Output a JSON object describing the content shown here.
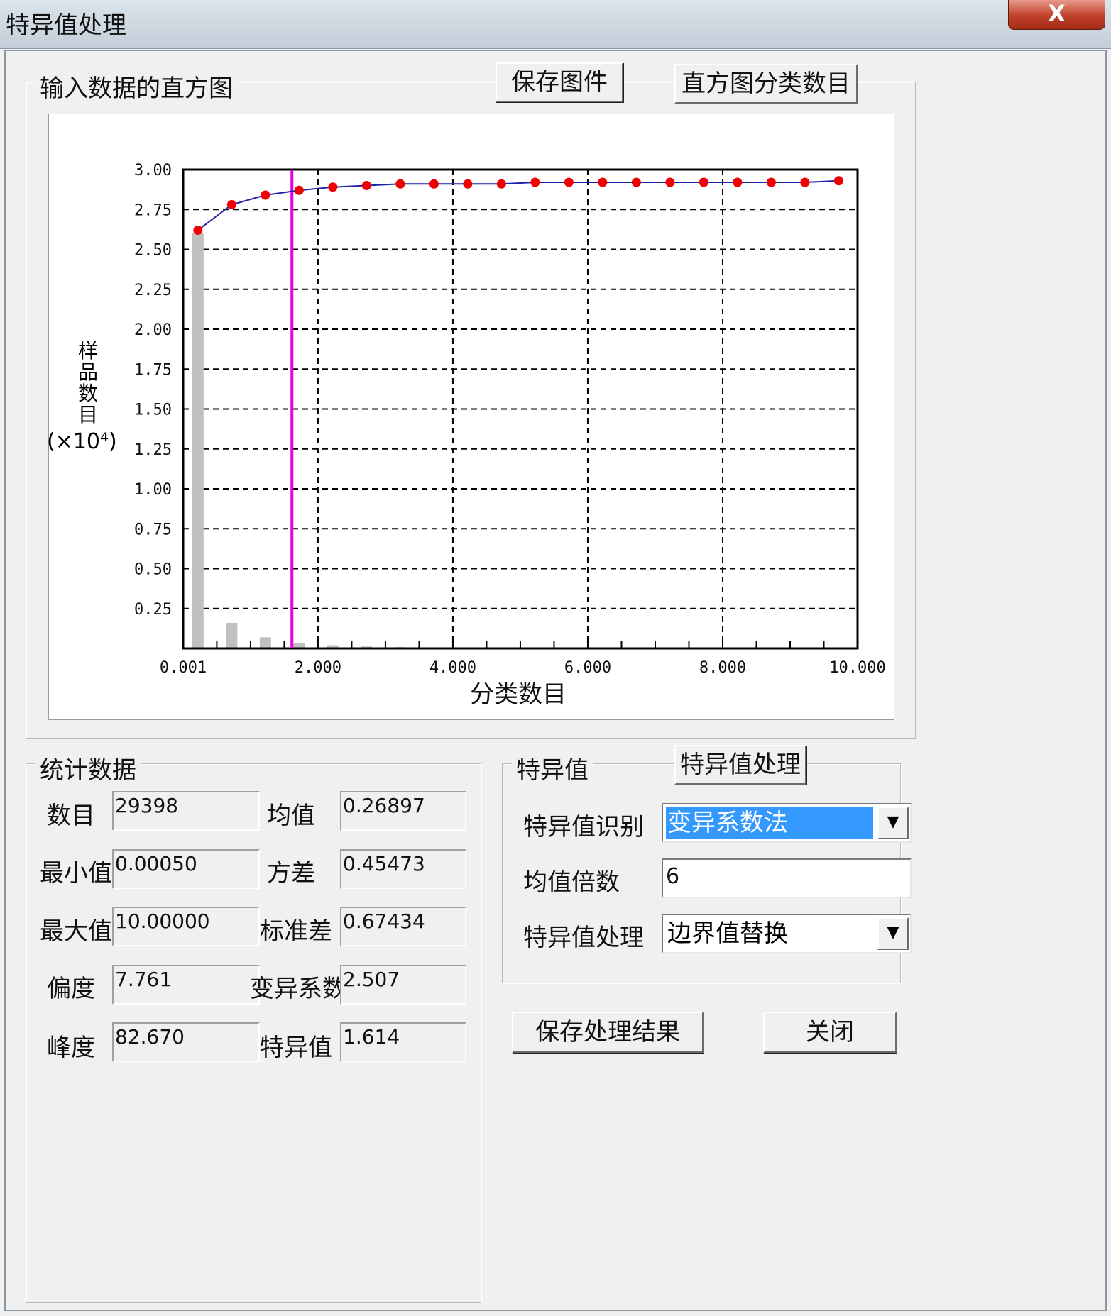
{
  "window": {
    "title": "特异值处理",
    "close_glyph": "X"
  },
  "histogram": {
    "group_title": "输入数据的直方图",
    "save_figure_button": "保存图件",
    "bins_button": "直方图分类数目"
  },
  "chart_data": {
    "type": "bar",
    "ylabel_chars": [
      "样",
      "品",
      "数",
      "目"
    ],
    "ylabel_unit": "(×10⁴)",
    "xlabel": "分类数目",
    "xticks": [
      "0.001",
      "2.000",
      "4.000",
      "6.000",
      "8.000",
      "10.000"
    ],
    "yticks": [
      "0.25",
      "0.50",
      "0.75",
      "1.00",
      "1.25",
      "1.50",
      "1.75",
      "2.00",
      "2.25",
      "2.50",
      "2.75",
      "3.00"
    ],
    "xlim": [
      0.001,
      10.0
    ],
    "ylim": [
      0,
      3.0
    ],
    "grid": true,
    "bars": {
      "x": [
        0.22,
        0.72,
        1.22,
        1.72,
        2.22,
        2.72,
        3.22
      ],
      "values": [
        2.6,
        0.16,
        0.07,
        0.035,
        0.02,
        0.012,
        0.008
      ],
      "color": "#c0c0c0"
    },
    "cumulative_line": {
      "x": [
        0.22,
        0.72,
        1.22,
        1.72,
        2.22,
        2.72,
        3.22,
        3.72,
        4.22,
        4.72,
        5.22,
        5.72,
        6.22,
        6.72,
        7.22,
        7.72,
        8.22,
        8.72,
        9.22,
        9.72
      ],
      "values": [
        2.62,
        2.78,
        2.84,
        2.87,
        2.89,
        2.9,
        2.91,
        2.91,
        2.91,
        2.91,
        2.92,
        2.92,
        2.92,
        2.92,
        2.92,
        2.92,
        2.92,
        2.92,
        2.92,
        2.93
      ],
      "line_color": "#1f1fa8",
      "marker_color": "#ee0000"
    },
    "threshold_line": {
      "x": 1.614,
      "color": "#e600e6"
    }
  },
  "stats": {
    "group_title": "统计数据",
    "rows": [
      {
        "left_label": "数目",
        "left_value": "29398",
        "right_label": "均值",
        "right_value": "0.26897"
      },
      {
        "left_label": "最小值",
        "left_value": "0.00050",
        "right_label": "方差",
        "right_value": "0.45473"
      },
      {
        "left_label": "最大值",
        "left_value": "10.00000",
        "right_label": "标准差",
        "right_value": "0.67434"
      },
      {
        "left_label": "偏度",
        "left_value": "7.761",
        "right_label": "变异系数",
        "right_value": "2.507"
      },
      {
        "left_label": "峰度",
        "left_value": "82.670",
        "right_label": "特异值",
        "right_value": "1.614"
      }
    ]
  },
  "outlier": {
    "group_title": "特异值",
    "process_button": "特异值处理",
    "identify_label": "特异值识别",
    "identify_value": "变异系数法",
    "multiple_label": "均值倍数",
    "multiple_value": "6",
    "handle_label": "特异值处理",
    "handle_value": "边界值替换"
  },
  "footer": {
    "save_result_button": "保存处理结果",
    "close_button": "关闭"
  }
}
